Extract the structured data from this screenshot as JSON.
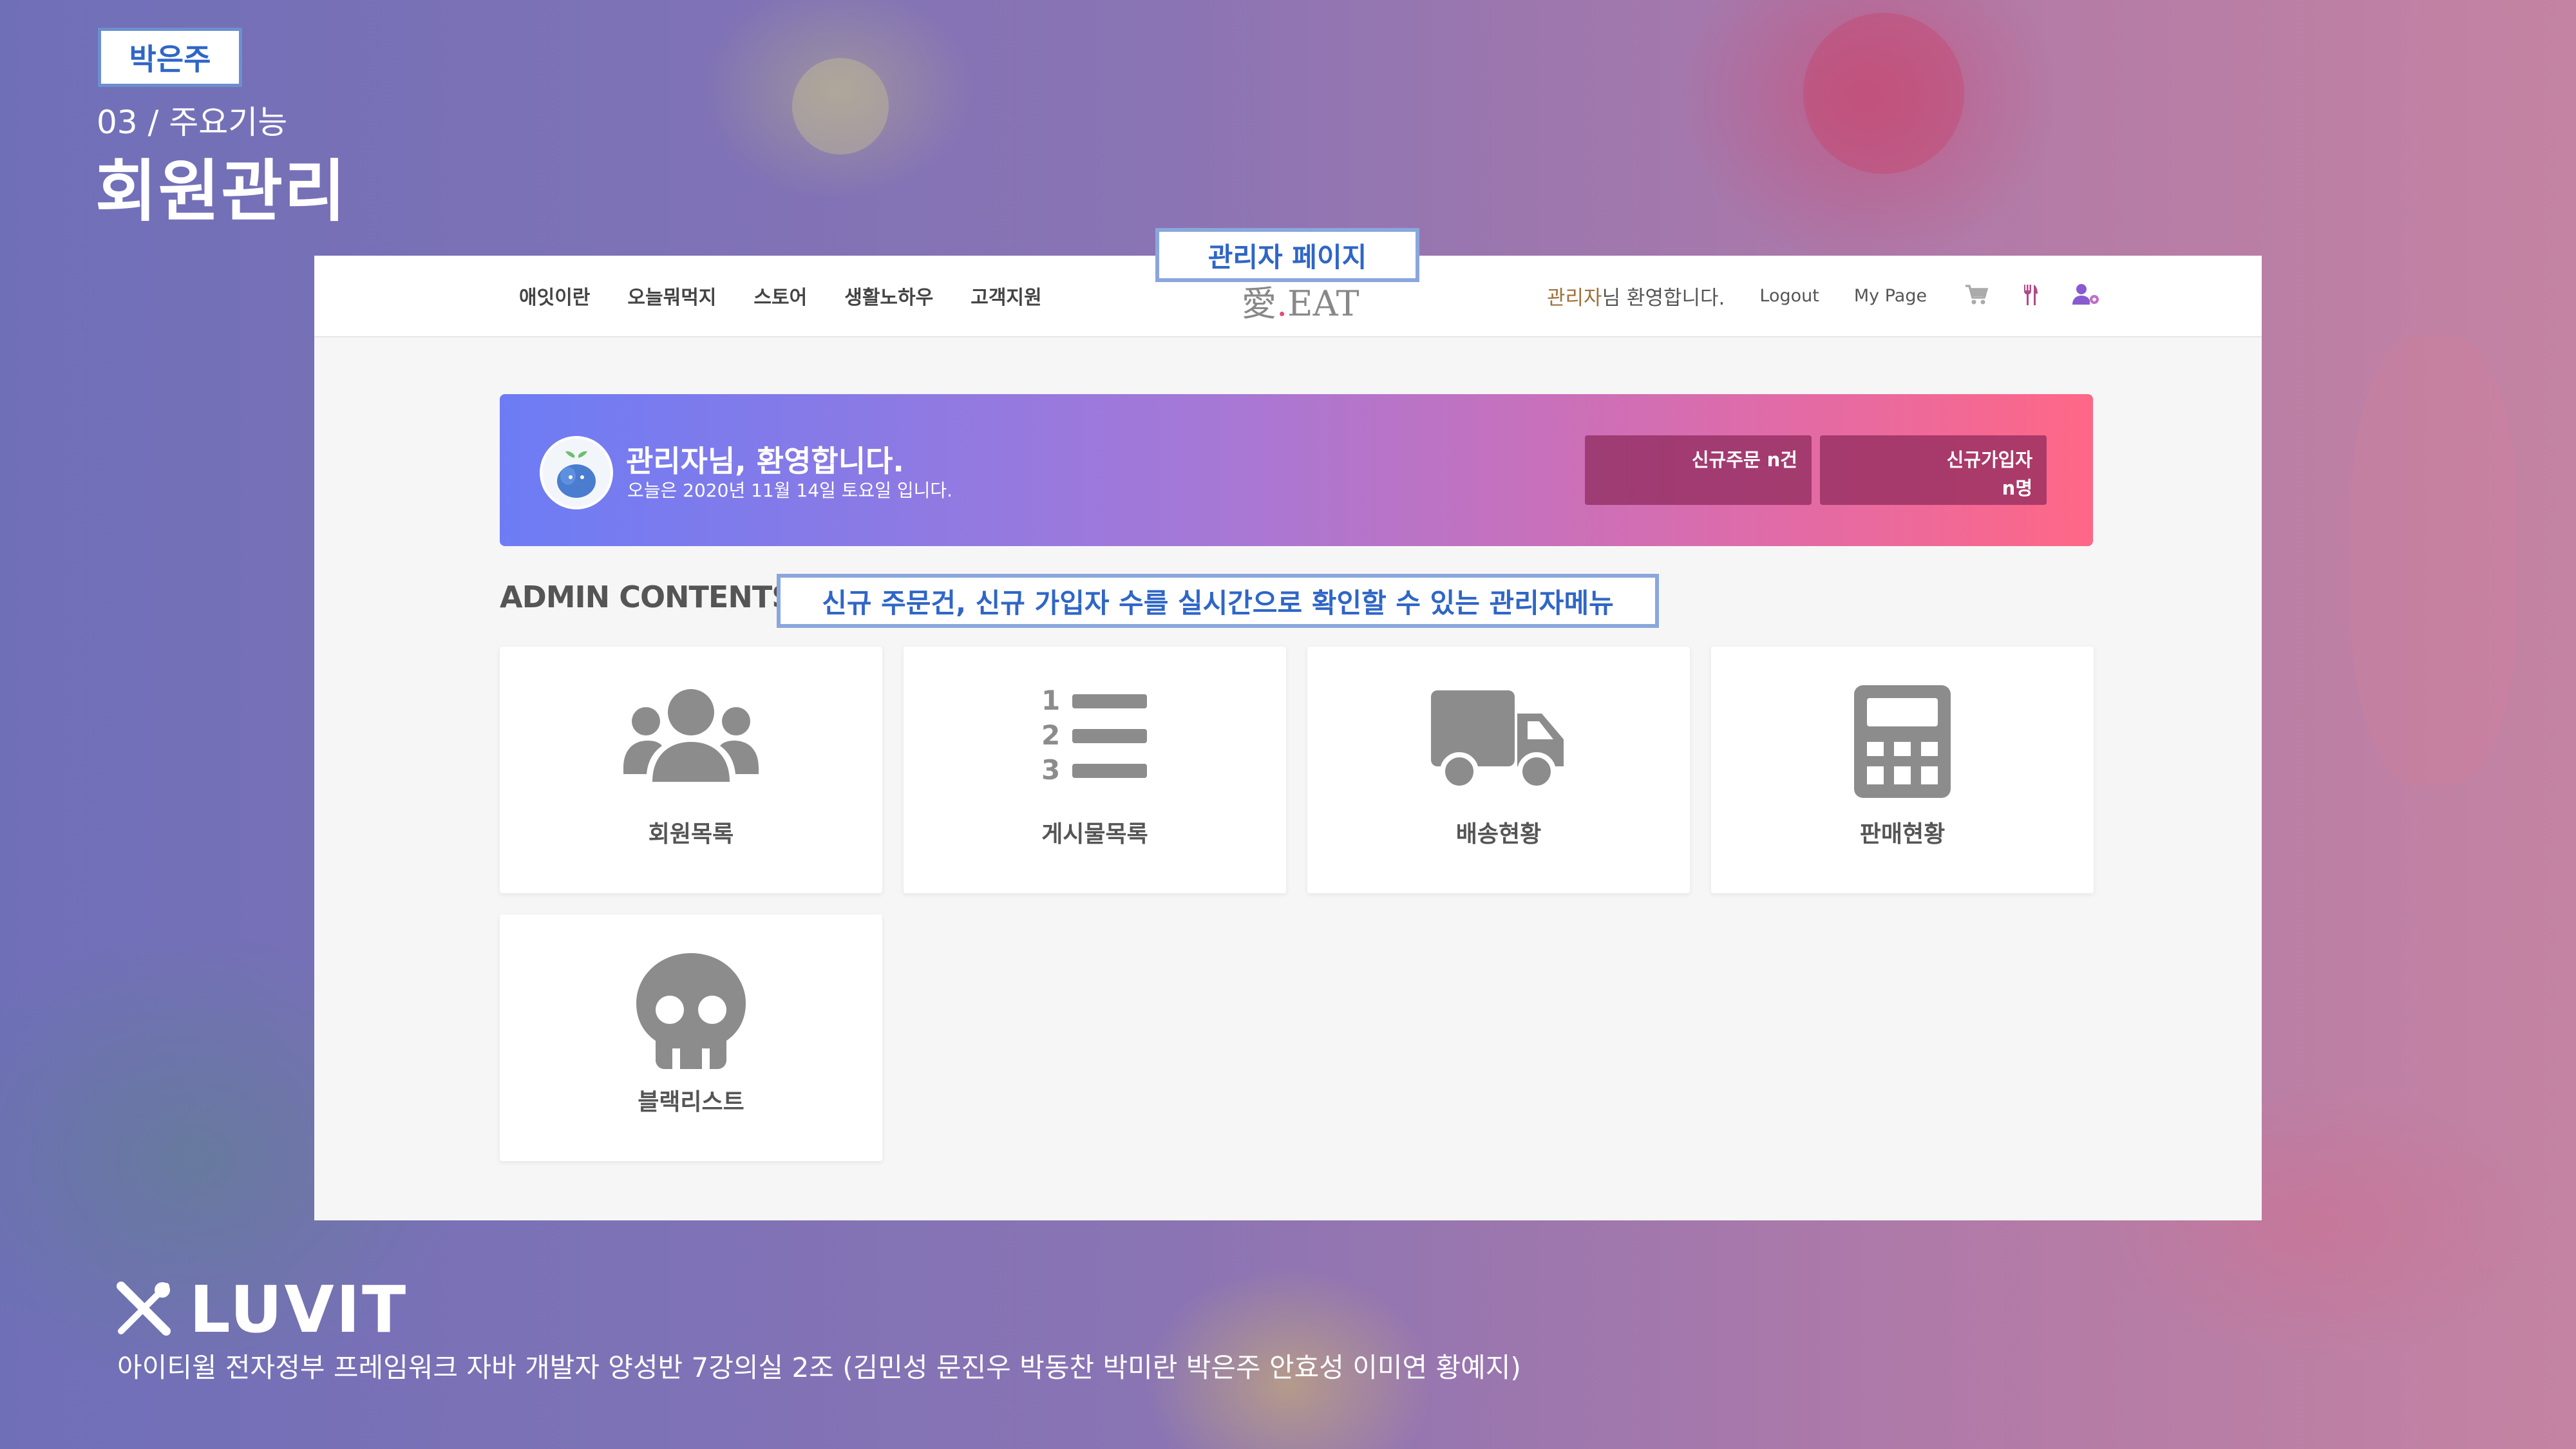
{
  "slide": {
    "presenter": "박은주",
    "section_number": "03 / 주요기능",
    "section_title": "회원관리",
    "brand_name": "LUVIT",
    "credits": "아이티윌 전자정부 프레임워크 자바 개발자 양성반 7강의실 2조 (김민성 문진우 박동찬 박미란 박은주 안효성 이미연 황예지)"
  },
  "callouts": {
    "admin_page": "관리자 페이지",
    "admin_menu": "신규 주문건, 신규 가입자 수를 실시간으로 확인할 수 있는 관리자메뉴"
  },
  "navbar": {
    "menu": [
      "애잇이란",
      "오늘뭐먹지",
      "스토어",
      "생활노하우",
      "고객지원"
    ],
    "logo_main": "愛",
    "logo_dot": ".",
    "logo_tail": "EAT",
    "welcome_name": "관리자",
    "welcome_suffix": "님 환영합니다.",
    "logout": "Logout",
    "mypage": "My Page",
    "icons": [
      "cart-icon",
      "utensils-icon",
      "user-settings-icon"
    ]
  },
  "hero": {
    "title": "관리자님, 환영합니다.",
    "date_text": "오늘은 2020년 11월 14일 토요일 입니다.",
    "new_orders": "신규주문 n건",
    "new_members_label": "신규가입자",
    "new_members_count": "n명"
  },
  "admin": {
    "heading": "ADMIN CONTENTS",
    "cards": [
      {
        "label": "회원목록",
        "icon": "users-icon"
      },
      {
        "label": "게시물목록",
        "icon": "ordered-list-icon"
      },
      {
        "label": "배송현황",
        "icon": "truck-icon"
      },
      {
        "label": "판매현황",
        "icon": "calculator-icon"
      },
      {
        "label": "블랙리스트",
        "icon": "skull-icon"
      }
    ]
  },
  "colors": {
    "hero_gradient_start": "#6d7cf5",
    "hero_gradient_end": "#ff6786",
    "callout_border": "#8aa7dc",
    "callout_text": "#2f66c7",
    "icon_gray": "#8c8c8c"
  }
}
